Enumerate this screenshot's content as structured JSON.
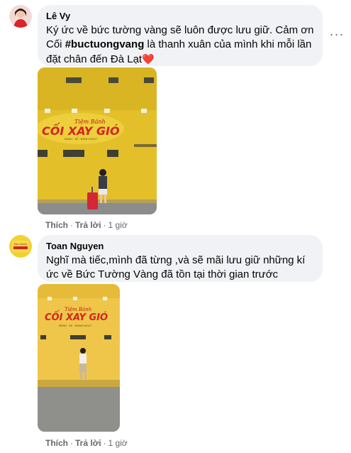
{
  "comments": [
    {
      "author": "Lê Vy",
      "text_before": "Ký ức về bức tường vàng sẽ luôn được lưu giữ. Cảm ơn Cối ",
      "hashtag": "#buctuongvang",
      "text_after": " là thanh xuân của mình khi mỗi lần đặt chân đến Đà Lạt",
      "heart": "❤️",
      "more": "···",
      "photo_sign": {
        "line1": "Tiệm Bánh",
        "line2": "CỐI XAY GIÓ",
        "line3": "BÁNH · MÌ · BÁNH NGỌT"
      },
      "like_label": "Thích",
      "reply_label": "Trả lời",
      "separator": "·",
      "time": "1 giờ"
    },
    {
      "author": "Toan Nguyen",
      "avatar_text": "Tiệm Bánh",
      "text": "Nghĩ mà tiếc,mình đã từng ,và sẽ mãi lưu giữ những kí ức về Bức Tường Vàng đã tồn tại thời gian trước",
      "photo_sign": {
        "line1": "Tiệm Bánh",
        "line2": "CỐI XAY GIÓ",
        "line3": "BÁNH · MÌ · BÁNH NGỌT"
      },
      "like_label": "Thích",
      "reply_label": "Trả lời",
      "separator": "·",
      "time": "1 giờ"
    }
  ],
  "colors": {
    "bubble_bg": "#f0f2f5",
    "meta_text": "#65676b",
    "wall_yellow": "#e8c42b",
    "sign_red": "#d4231f"
  }
}
